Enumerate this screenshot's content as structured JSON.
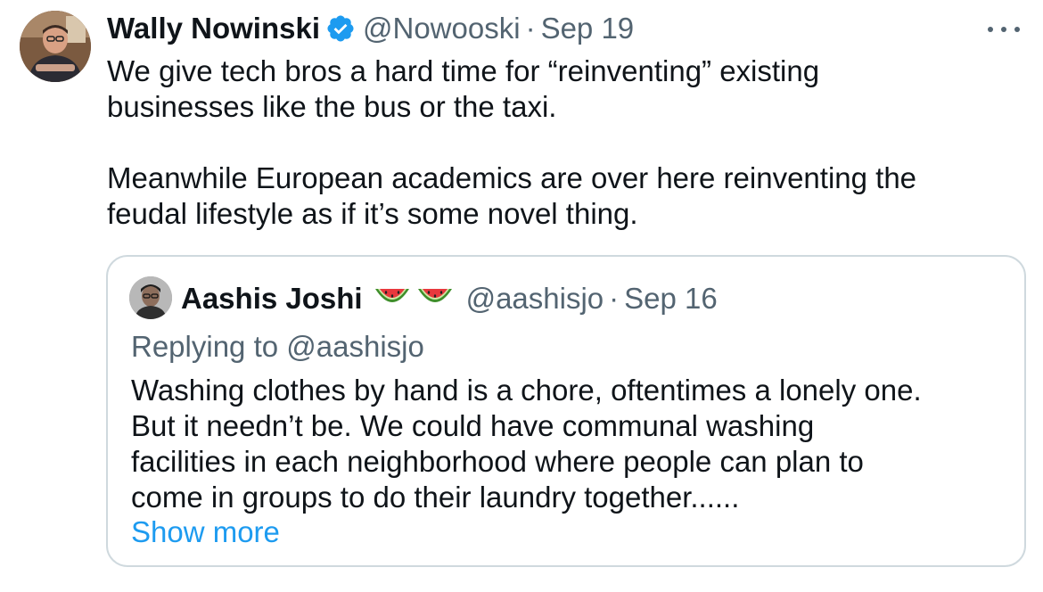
{
  "tweet": {
    "author_name": "Wally Nowinski",
    "author_handle": "@Nowooski",
    "separator": "·",
    "date": "Sep 19",
    "verified_icon": "verified-badge-icon",
    "more_icon": "more-options-icon",
    "body_lines": [
      "We give tech bros a hard time for “reinventing” existing",
      "businesses like the bus or the taxi.",
      "Meanwhile European academics are over here reinventing the",
      "feudal lifestyle as if it’s some novel thing."
    ]
  },
  "quoted_tweet": {
    "author_name": "Aashis Joshi",
    "author_emoji": "watermelon-icon",
    "author_handle": "@aashisjo",
    "separator": "·",
    "date": "Sep 16",
    "replying_to": "Replying to @aashisjo",
    "text_lines": [
      "Washing clothes by hand is a chore, oftentimes a lonely one.",
      "But it needn’t be. We could have communal washing",
      "facilities in each neighborhood where people can plan to",
      "come in groups to do their laundry together......"
    ],
    "show_more": "Show more"
  },
  "colors": {
    "text_primary": "#0f1419",
    "text_secondary": "#536471",
    "link": "#1d9bf0",
    "border": "#cfd9de",
    "verified": "#1d9bf0"
  }
}
